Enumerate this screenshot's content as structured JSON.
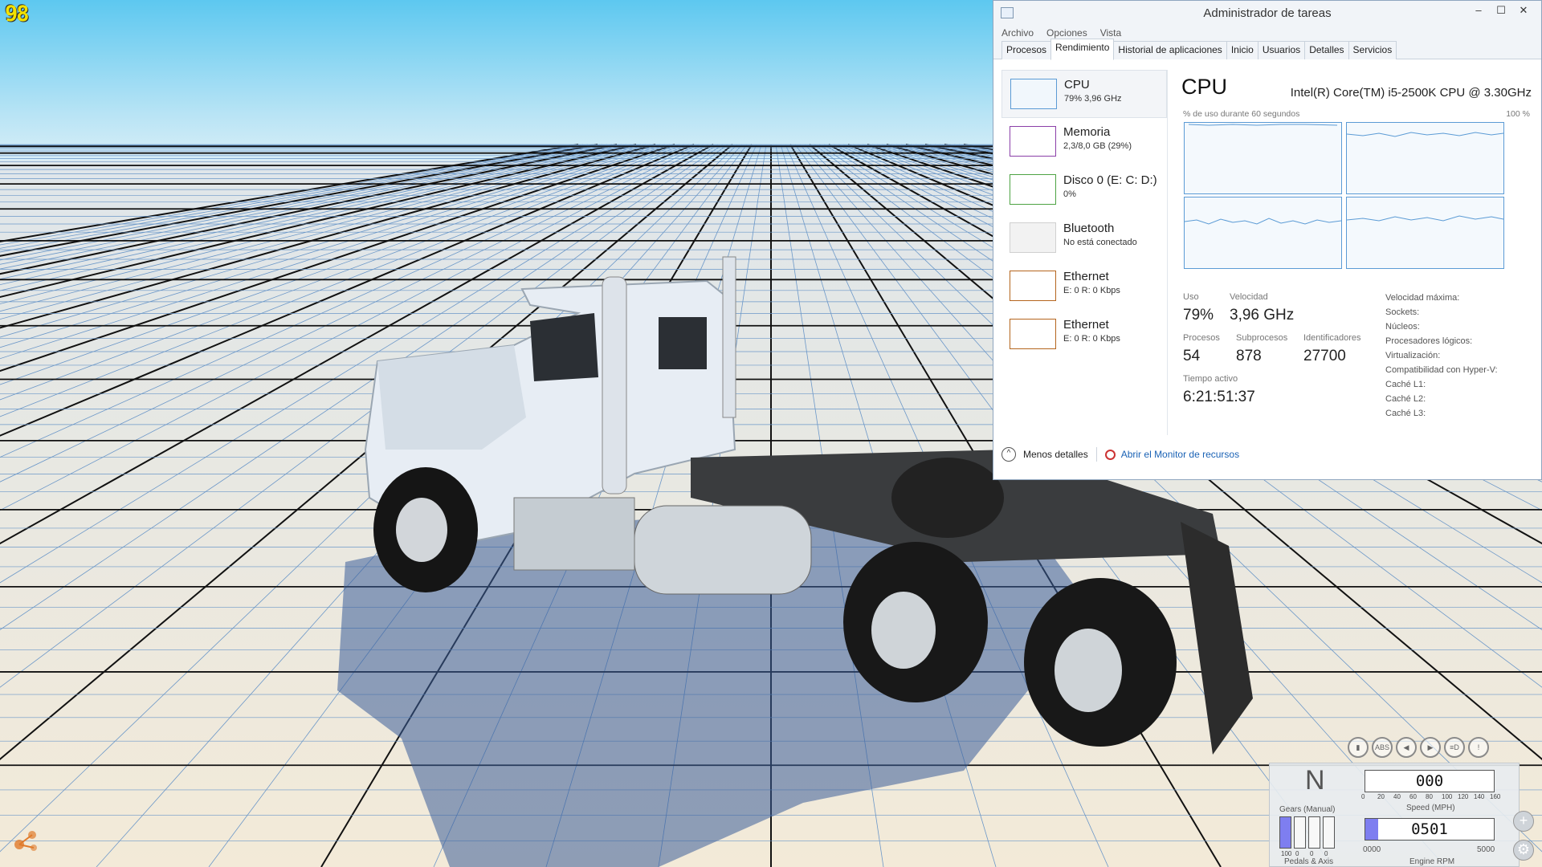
{
  "game": {
    "fps": "98"
  },
  "task_manager": {
    "title": "Administrador de tareas",
    "window_buttons": [
      "–",
      "☐",
      "✕"
    ],
    "menu": [
      "Archivo",
      "Opciones",
      "Vista"
    ],
    "tabs": [
      "Procesos",
      "Rendimiento",
      "Historial de aplicaciones",
      "Inicio",
      "Usuarios",
      "Detalles",
      "Servicios"
    ],
    "active_tab": "Rendimiento",
    "devices": [
      {
        "name": "CPU",
        "sub": "79% 3,96 GHz",
        "color": "#5b9bd5"
      },
      {
        "name": "Memoria",
        "sub": "2,3/8,0 GB (29%)",
        "color": "#8b3fa8"
      },
      {
        "name": "Disco 0 (E: C: D:)",
        "sub": "0%",
        "color": "#4da343"
      },
      {
        "name": "Bluetooth",
        "sub": "No está conectado",
        "color": "#c8c8c8"
      },
      {
        "name": "Ethernet",
        "sub": "E: 0 R: 0 Kbps",
        "color": "#b5651d"
      },
      {
        "name": "Ethernet",
        "sub": "E: 0 R: 0 Kbps",
        "color": "#b5651d"
      }
    ],
    "detail": {
      "heading": "CPU",
      "model": "Intel(R) Core(TM) i5-2500K CPU @ 3.30GHz",
      "usage_caption": "% de uso durante 60 segundos",
      "max_pct": "100 %",
      "uso_label": "Uso",
      "uso": "79%",
      "velocidad_label": "Velocidad",
      "velocidad": "3,96 GHz",
      "procesos_label": "Procesos",
      "procesos": "54",
      "subprocesos_label": "Subprocesos",
      "subprocesos": "878",
      "identificadores_label": "Identificadores",
      "identificadores": "27700",
      "tiempo_label": "Tiempo activo",
      "tiempo": "6:21:51:37",
      "specs": [
        "Velocidad máxima:",
        "Sockets:",
        "Núcleos:",
        "Procesadores lógicos:",
        "Virtualización:",
        "Compatibilidad con Hyper-V:",
        "Caché L1:",
        "Caché L2:",
        "Caché L3:"
      ]
    },
    "footer": {
      "less_details": "Menos detalles",
      "resource_monitor": "Abrir el Monitor de recursos"
    }
  },
  "hud": {
    "gear": "N",
    "gears_label": "Gears (Manual)",
    "speed": "000",
    "speed_label": "Speed (MPH)",
    "speed_ticks": [
      "0",
      "20",
      "40",
      "60",
      "80",
      "100",
      "120",
      "140",
      "160"
    ],
    "rpm": "0501",
    "rpm_label": "Engine RPM",
    "rpm_min": "0000",
    "rpm_max": "5000",
    "rpm_fraction": 0.1,
    "pedals_label": "Pedals & Axis",
    "pedal_ticks": [
      "100",
      "0",
      "0",
      "0"
    ],
    "pedal_levels": [
      1.0,
      0.0,
      0.0,
      0.0
    ],
    "icons": [
      "fuel-icon",
      "abs-icon",
      "left-signal-icon",
      "right-signal-icon",
      "headlight-icon",
      "warning-icon"
    ]
  }
}
